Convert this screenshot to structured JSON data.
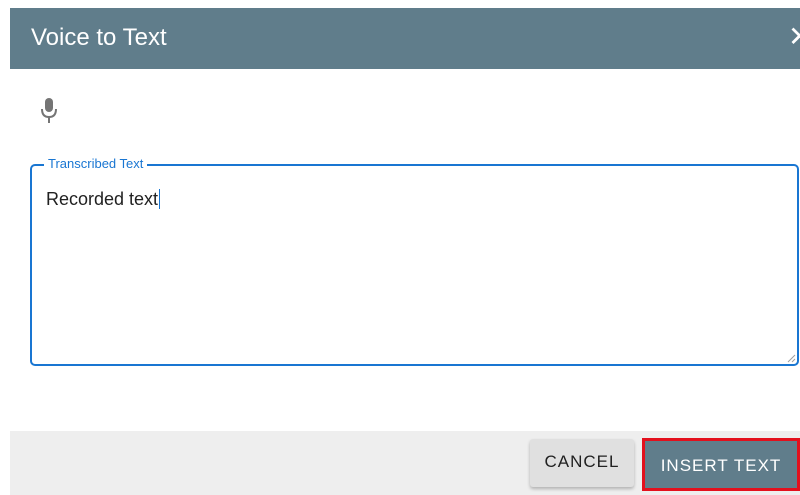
{
  "dialog": {
    "title": "Voice to Text",
    "close_glyph": "✕",
    "header_color": "#607d8b"
  },
  "mic": {
    "icon": "microphone-icon"
  },
  "transcription": {
    "label": "Transcribed Text",
    "value": "Recorded text",
    "accent_color": "#1976d2"
  },
  "actions": {
    "cancel_label": "CANCEL",
    "insert_label": "INSERT TEXT",
    "highlight_color": "#e3101d"
  }
}
